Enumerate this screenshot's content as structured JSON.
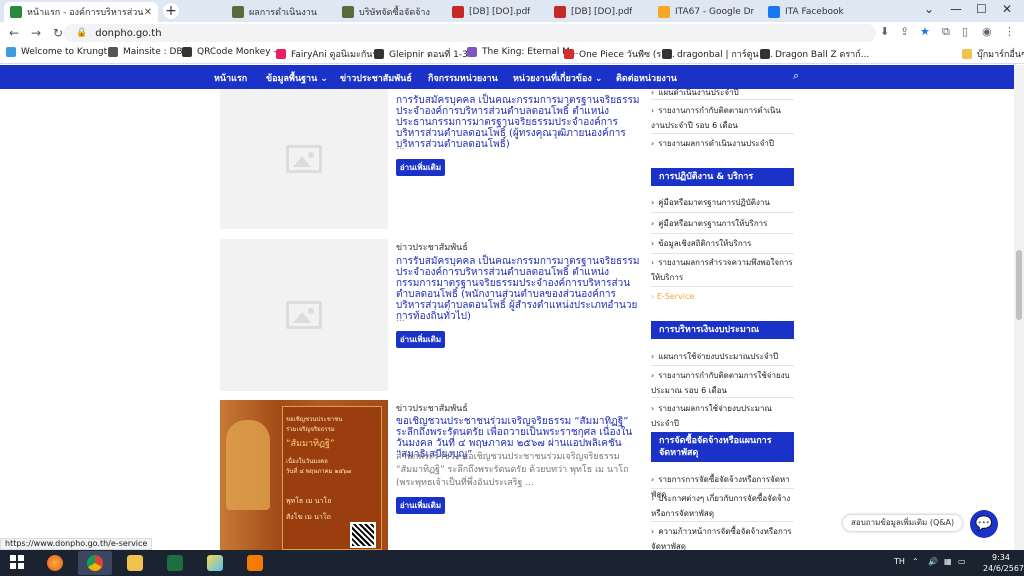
{
  "browser": {
    "tabs": [
      {
        "label": "หน้าแรก - องค์การบริหารส่วนตำบล",
        "color": "#2b8a3e",
        "active": true
      },
      {
        "label": "ผลการดำเนินงาน",
        "color": "#5b6b3a"
      },
      {
        "label": "บริษัทจัดซื้อจัดจ้าง",
        "color": "#5b6b3a"
      },
      {
        "label": "[DB] [DO].pdf",
        "color": "#c62828"
      },
      {
        "label": "[DB] [DO].pdf",
        "color": "#c62828"
      },
      {
        "label": "ITA67 - Google Dr",
        "color": "#f9a825"
      },
      {
        "label": "ITA Facebook",
        "color": "#1877f2"
      }
    ],
    "new_tab": "+",
    "window_controls": [
      "⌄",
      "—",
      "☐",
      "✕"
    ],
    "url": "donpho.go.th",
    "bookmarks": [
      {
        "label": "Welcome to Krungt...",
        "color": "#3b9ae1"
      },
      {
        "label": "Mainsite : DBD",
        "color": "#555555"
      },
      {
        "label": "QRCode Monkey -...",
        "color": "#333333"
      },
      {
        "label": "FairyAni ดูอนิเมะกันฟรี",
        "color": "#e91e63"
      },
      {
        "label": "Gleipnir ตอนที่ 1-3...",
        "color": "#333333"
      },
      {
        "label": "The King: Eternal M...",
        "color": "#7e57c2"
      },
      {
        "label": "One Piece วันพีซ (รว...",
        "color": "#d32f2f"
      },
      {
        "label": "dragonbal | การ์ตูน |...",
        "color": "#333333"
      },
      {
        "label": "Dragon Ball Z ดราก์...",
        "color": "#333333"
      }
    ],
    "bookmarks_folder": "บุ๊กมาร์กอื่นๆ"
  },
  "site_nav": {
    "items": [
      "หน้าแรก",
      "ข้อมูลพื้นฐาน ⌄",
      "ข่าวประชาสัมพันธ์",
      "กิจกรรมหน่วยงาน",
      "หน่วยงานที่เกี่ยวข้อง ⌄",
      "ติดต่อหน่วยงาน"
    ],
    "search_icon": "search-icon"
  },
  "posts": [
    {
      "title": "การรับสมัครบุคคล เป็นคณะกรรมการมาตรฐานจริยธรรมประจำองค์การบริหารส่วนตำบลดอนโพธิ์ ตำแหน่ง ประธานกรรมการมาตรฐานจริยธรรมประจำองค์การบริหารส่วนตำบลดอนโพธิ์ (ผู้ทรงคุณวุฒิภายนองค์การบริหารส่วนตำบลดอนโพธิ์)",
      "excerpt": "...",
      "read_more": "อ่านเพิ่มเติม"
    },
    {
      "category": "ข่าวประชาสัมพันธ์",
      "title": "การรับสมัครบุคคล เป็นคณะกรรมการมาตรฐานจริยธรรมประจำองค์การบริหารส่วนตำบลดอนโพธิ์ ตำแหน่ง กรรมการมาตรฐานจริยธรรมประจำองค์การบริหารส่วนตำบลดอนโพธิ์ (พนักงานส่วนตำบลของส่วนองค์การบริหารส่วนตำบลดอนโพธิ์ ผู้สำรงตำแหน่งประเภทอำนวยการท้องถิ่นทั่วไป)",
      "excerpt": "...",
      "read_more": "อ่านเพิ่มเติม"
    },
    {
      "category": "ข่าวประชาสัมพันธ์",
      "title": "ขอเชิญชวนประชาชนร่วมเจริญจริยธรรม “สัมมาทิฏฐิ” ระลึกถึงพระรัตนตรัย เพื่อถวายเป็นพระราชกุศล เนื่องในวันมงคล วันที่ ๔ พฤษภาคม ๒๕๖๗ ผ่านแอปพลิเคชัน “สมาธิเสบียงบุญ”",
      "excerpt": "สำนักพระราชวัง ขอเชิญชวนประชาชนร่วมเจริญจริยธรรม “สัมมาทิฏฐิ” ระลึกถึงพระรัตนตรัย ด้วยบทว่า พุทโธ เม นาโถ (พระพุทธเจ้าเป็นที่พึ่งอันประเสริฐ ...",
      "read_more": "อ่านเพิ่มเติม",
      "poster_text": [
        "ขอเชิญชวนประชาชน",
        "ร่วมเจริญจริยธรรม",
        "“สัมมาทิฏฐิ”",
        "เนื่องในวันมงคล",
        "วันที่ ๔ พฤษภาคม ๒๕๖๗",
        "พุทโธ เม นาโถ",
        "สังโฆ เม นาโถ"
      ]
    }
  ],
  "sidebar": {
    "top_items": [
      "แผนดำเนินงานประจำปี",
      "รายงานการกำกับติดตามการดำเนินงานประจำปี รอบ 6 เดือน",
      "รายงานผลการดำเนินงานประจำปี"
    ],
    "sections": [
      {
        "heading": "การปฏิบัติงาน & บริการ",
        "items": [
          "คู่มือหรือมาตรฐานการปฏิบัติงาน",
          "คู่มือหรือมาตรฐานการให้บริการ",
          "ข้อมูลเชิงสถิติการให้บริการ",
          "รายงานผลการสำรวจความพึงพอใจการให้บริการ"
        ],
        "extra": "E-Service"
      },
      {
        "heading": "การบริหารเงินงบประมาณ",
        "items": [
          "แผนการใช้จ่ายงบประมาณประจำปี",
          "รายงานการกำกับติดตามการใช้จ่ายงบประมาณ รอบ 6 เดือน",
          "รายงานผลการใช้จ่ายงบประมาณประจำปี"
        ]
      },
      {
        "heading": "การจัดซื้อจัดจ้างหรือแผนการจัดหาพัสดุ",
        "items": [
          "รายการการจัดซื้อจัดจ้างหรือการจัดหาพัสดุ",
          "ประกาศต่างๆ เกี่ยวกับการจัดซื้อจัดจ้างหรือการจัดหาพัสดุ",
          "ความก้าวหน้าการจัดซื้อจัดจ้างหรือการจัดหาพัสดุ"
        ]
      }
    ]
  },
  "chat": {
    "label": "สอบถามข้อมูลเพิ่มเติม (Q&A)"
  },
  "status_url": "https://www.donpho.go.th/e-service",
  "taskbar": {
    "apps": [
      "firefox",
      "chrome",
      "file-explorer",
      "excel",
      "paint",
      "app-g"
    ],
    "tray_lang": "TH",
    "time": "9:34",
    "date": "24/6/2567"
  }
}
